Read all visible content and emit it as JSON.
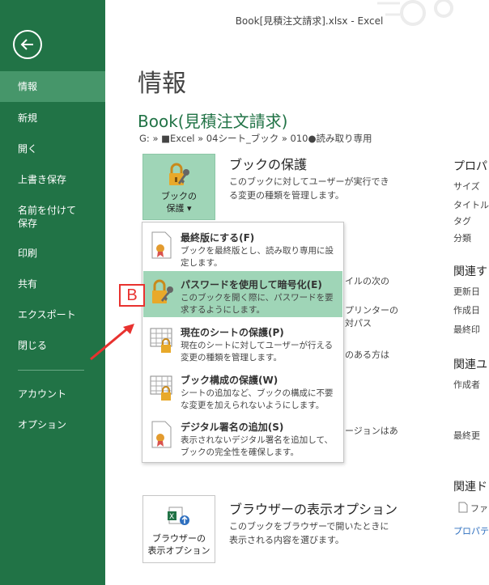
{
  "window": {
    "title": "Book[見積注文請求].xlsx - Excel"
  },
  "sidebar": {
    "items": [
      {
        "label": "情報"
      },
      {
        "label": "新規"
      },
      {
        "label": "開く"
      },
      {
        "label": "上書き保存"
      },
      {
        "label": "名前を付けて\n保存"
      },
      {
        "label": "印刷"
      },
      {
        "label": "共有"
      },
      {
        "label": "エクスポート"
      },
      {
        "label": "閉じる"
      },
      {
        "label": "アカウント"
      },
      {
        "label": "オプション"
      }
    ]
  },
  "main": {
    "page_title": "情報",
    "book_name": "Book(見積注文請求)",
    "path": "G: » ■Excel » 04シート_ブック » 010●読み取り専用",
    "protect": {
      "button_label": "ブックの\n保護 ▾",
      "title": "ブックの保護",
      "desc": "このブックに対してユーザーが実行できる変更の種類を管理します。"
    },
    "fragments": {
      "f1": "イルの次の",
      "f2": "プリンターの",
      "f3": "対パス",
      "f4": "のある方は",
      "f5": "ージョンはあ"
    },
    "browser": {
      "button_label": "ブラウザーの\n表示オプション",
      "title": "ブラウザーの表示オプション",
      "desc": "このブックをブラウザーで開いたときに表示される内容を選びます。"
    }
  },
  "right_panel": {
    "properties": "プロパ",
    "size": "サイズ",
    "title": "タイトル",
    "tag": "タグ",
    "category": "分類",
    "related_dates": "関連す",
    "updated": "更新日",
    "created": "作成日",
    "last_printed": "最終印",
    "related_people": "関連ユ",
    "author": "作成者",
    "last_modified": "最終更",
    "related_docs": "関連ド",
    "open_file": "ファ",
    "props_link": "プロパテ"
  },
  "menu": {
    "items": [
      {
        "title": "最終版にする(F)",
        "desc": "ブックを最終版とし、読み取り専用に設定します。"
      },
      {
        "title": "パスワードを使用して暗号化(E)",
        "desc": "このブックを開く際に、パスワードを要求するようにします。"
      },
      {
        "title": "現在のシートの保護(P)",
        "desc": "現在のシートに対してユーザーが行える変更の種類を管理します。"
      },
      {
        "title": "ブック構成の保護(W)",
        "desc": "シートの追加など、ブックの構成に不要な変更を加えられないようにします。"
      },
      {
        "title": "デジタル署名の追加(S)",
        "desc": "表示されないデジタル署名を追加して、ブックの完全性を確保します。"
      }
    ]
  },
  "annotation": {
    "label": "B"
  },
  "colors": {
    "accent": "#217346",
    "hover": "#9fd5b7",
    "annotation": "#e8322f"
  },
  "icons": [
    "back-arrow-icon",
    "lock-key-icon",
    "certificate-icon",
    "sheet-lock-icon",
    "excel-browser-icon",
    "document-icon"
  ]
}
